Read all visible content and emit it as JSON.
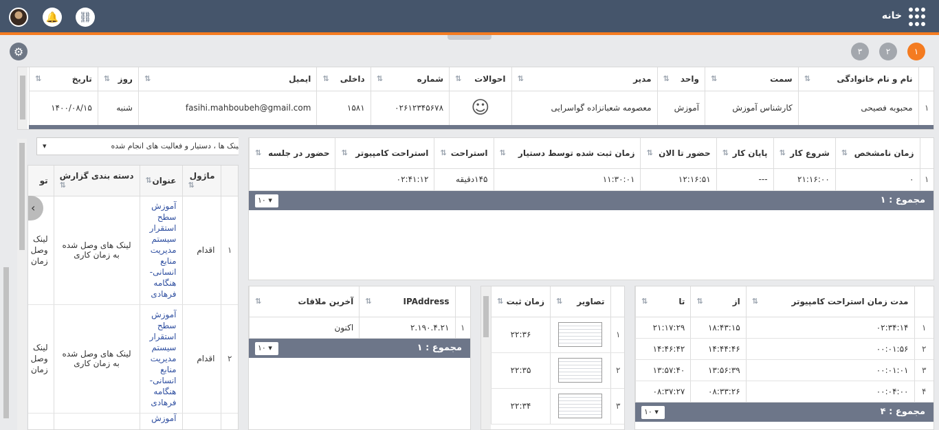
{
  "header": {
    "home_label": "خانه"
  },
  "tabs": {
    "t1": "۱",
    "t2": "۲",
    "t3": "۳"
  },
  "profile": {
    "columns": [
      "نام و نام خانوادگی",
      "سمت",
      "واحد",
      "مدیر",
      "احوالات",
      "شماره",
      "داخلی",
      "ایمیل",
      "روز",
      "تاریخ"
    ],
    "row": {
      "idx": "۱",
      "name": "محبوبه فصیحی",
      "position": "کارشناس آموزش",
      "unit": "آموزش",
      "manager": "معصومه شعبانزاده گواسرایی",
      "mood": "☺",
      "phone": "۰۲۶۱۲۳۴۵۶۷۸",
      "ext": "۱۵۸۱",
      "email": "fasihi.mahboubeh@gmail.com",
      "day": "شنبه",
      "date": "۱۴۰۰/۰۸/۱۵"
    }
  },
  "presence": {
    "columns": [
      "زمان نامشخص",
      "شروع کار",
      "پایان کار",
      "حضور تا الان",
      "زمان ثبت شده توسط دستیار",
      "استراحت",
      "استراحت کامپیوتر",
      "حضور در جلسه"
    ],
    "row": {
      "idx": "۱",
      "unknown": "۰",
      "start": "۲۱:۱۶:۰۰",
      "end": "---",
      "present": "۱۲:۱۶:۵۱",
      "assistant": "۱۱:۳۰:۰۱",
      "rest": "۱۴۵دقیقه",
      "pc_rest": "۰۲:۴۱:۱۲",
      "meeting": ""
    },
    "total": "مجموع : ۱",
    "pager": "۱۰"
  },
  "links": {
    "select": "لینک ها ، دستیار و فعالیت های انجام شده",
    "columns": [
      "ماژول",
      "عنوان",
      "دسته بندی گزارش",
      "تو"
    ],
    "rows": [
      {
        "idx": "۱",
        "module": "اقدام",
        "title": "آموزش سطح استقرار سیستم مدیریت منابع انسانی-هنگامه فرهادی",
        "category": "لینک های وصل شده به زمان کاری",
        "extra": "لینک وصل زمان"
      },
      {
        "idx": "۲",
        "module": "اقدام",
        "title": "آموزش سطح استقرار سیستم مدیریت منابع انسانی-هنگامه فرهادی",
        "category": "لینک های وصل شده به زمان کاری",
        "extra": "لینک وصل زمان"
      },
      {
        "idx": "",
        "module": "",
        "title": "آموزش",
        "category": "",
        "extra": ""
      }
    ]
  },
  "ip": {
    "columns": [
      "IPAddress",
      "آخرین ملاقات"
    ],
    "row": {
      "idx": "۱",
      "ip": "۲.۱۹۰.۴.۲۱",
      "last": "اکنون"
    },
    "total": "مجموع : ۱",
    "pager": "۱۰"
  },
  "shots": {
    "columns": [
      "تصاویر",
      "زمان ثبت"
    ],
    "rows": [
      {
        "idx": "۱",
        "time": "۲۲:۳۶"
      },
      {
        "idx": "۲",
        "time": "۲۲:۳۵"
      },
      {
        "idx": "۳",
        "time": "۲۲:۳۴"
      }
    ]
  },
  "breaks": {
    "columns": [
      "مدت زمان استراحت کامپیوتر",
      "از",
      "تا"
    ],
    "rows": [
      {
        "idx": "۱",
        "dur": "۰۲:۳۴:۱۴",
        "from": "۱۸:۴۳:۱۵",
        "to": "۲۱:۱۷:۲۹"
      },
      {
        "idx": "۲",
        "dur": "۰۰:۰۱:۵۶",
        "from": "۱۴:۴۴:۴۶",
        "to": "۱۴:۴۶:۴۲"
      },
      {
        "idx": "۳",
        "dur": "۰۰:۰۱:۰۱",
        "from": "۱۳:۵۶:۳۹",
        "to": "۱۳:۵۷:۴۰"
      },
      {
        "idx": "۴",
        "dur": "۰۰:۰۴:۰۰",
        "from": "۰۸:۳۳:۲۶",
        "to": "۰۸:۳۷:۲۷"
      }
    ],
    "total": "مجموع : ۴",
    "pager": "۱۰"
  }
}
